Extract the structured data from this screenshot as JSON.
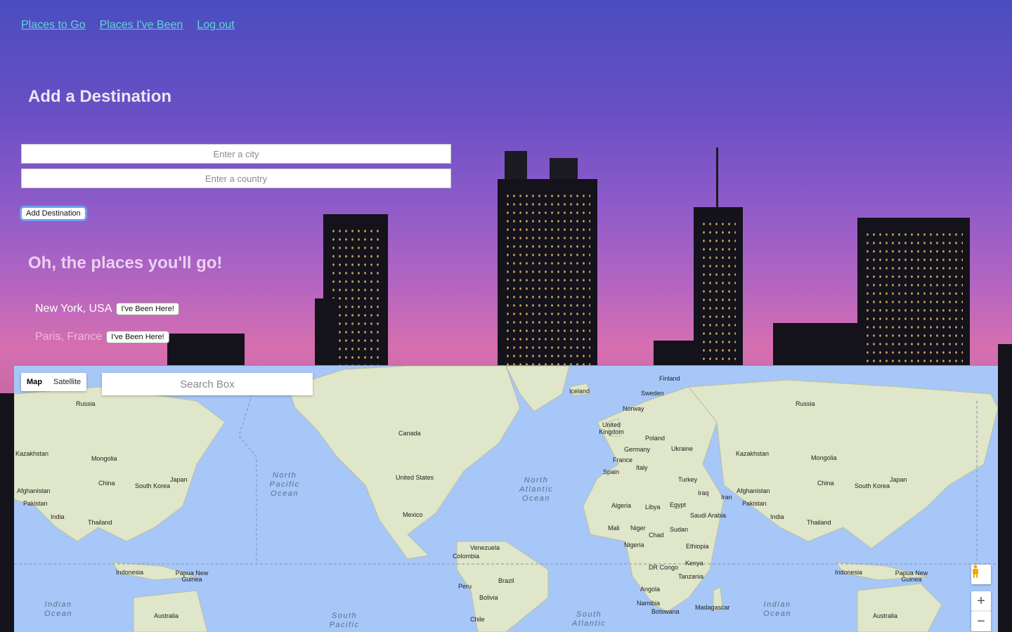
{
  "nav": {
    "links": [
      "Places to Go",
      "Places I've Been",
      "Log out"
    ]
  },
  "form": {
    "heading": "Add a Destination",
    "city_placeholder": "Enter a city",
    "country_placeholder": "Enter a country",
    "submit_label": "Add Destination"
  },
  "places": {
    "heading": "Oh, the places you'll go!",
    "items": [
      {
        "name": "New York, USA",
        "button": "I've Been Here!"
      },
      {
        "name": "Paris, France",
        "button": "I've Been Here!"
      }
    ]
  },
  "map": {
    "type_options": [
      "Map",
      "Satellite"
    ],
    "selected_type": "Map",
    "search_placeholder": "Search Box",
    "zoom_in": "+",
    "zoom_out": "−",
    "labels": {
      "iceland": "Iceland",
      "finland": "Finland",
      "sweden": "Sweden",
      "russia_e": "Russia",
      "russia_w": "Russia",
      "norway": "Norway",
      "uk": "United Kingdom",
      "poland": "Poland",
      "germany": "Germany",
      "ukraine": "Ukraine",
      "france": "France",
      "italy": "Italy",
      "spain": "Spain",
      "turkey": "Turkey",
      "kazakhstan_w": "Kazakhstan",
      "kazakhstan_e": "Kazakhstan",
      "mongolia_w": "Mongolia",
      "mongolia_e": "Mongolia",
      "china_w": "China",
      "china_e": "China",
      "skorea_w": "South Korea",
      "skorea_e": "South Korea",
      "japan_w": "Japan",
      "japan_e": "Japan",
      "afghanistan_w": "Afghanistan",
      "afghanistan_e": "Afghanistan",
      "pakistan_w": "Pakistan",
      "pakistan_e": "Pakistan",
      "india_w": "India",
      "india_e": "India",
      "thailand_w": "Thailand",
      "thailand_e": "Thailand",
      "indonesia_w": "Indonesia",
      "indonesia_e": "Indonesia",
      "png_w": "Papua New Guinea",
      "png_e": "Papua New Guinea",
      "australia_w": "Australia",
      "australia_e": "Australia",
      "canada": "Canada",
      "usa": "United States",
      "mexico": "Mexico",
      "venezuela": "Venezuela",
      "colombia": "Colombia",
      "peru": "Peru",
      "brazil": "Brazil",
      "bolivia": "Bolivia",
      "chile": "Chile",
      "algeria": "Algeria",
      "libya": "Libya",
      "egypt": "Egypt",
      "mali": "Mali",
      "niger": "Niger",
      "chad": "Chad",
      "sudan": "Sudan",
      "nigeria": "Nigeria",
      "ethiopia": "Ethiopia",
      "drcongo": "DR Congo",
      "kenya": "Kenya",
      "tanzania": "Tanzania",
      "angola": "Angola",
      "namibia": "Namibia",
      "botswana": "Botswana",
      "madagascar": "Madagascar",
      "iraq": "Iraq",
      "iran": "Iran",
      "saudi": "Saudi Arabia",
      "n_pacific": "North Pacific Ocean",
      "n_atlantic": "North Atlantic Ocean",
      "indian_w": "Indian Ocean",
      "indian_e": "Indian Ocean",
      "s_pacific": "South Pacific",
      "s_atlantic": "South Atlantic"
    }
  }
}
